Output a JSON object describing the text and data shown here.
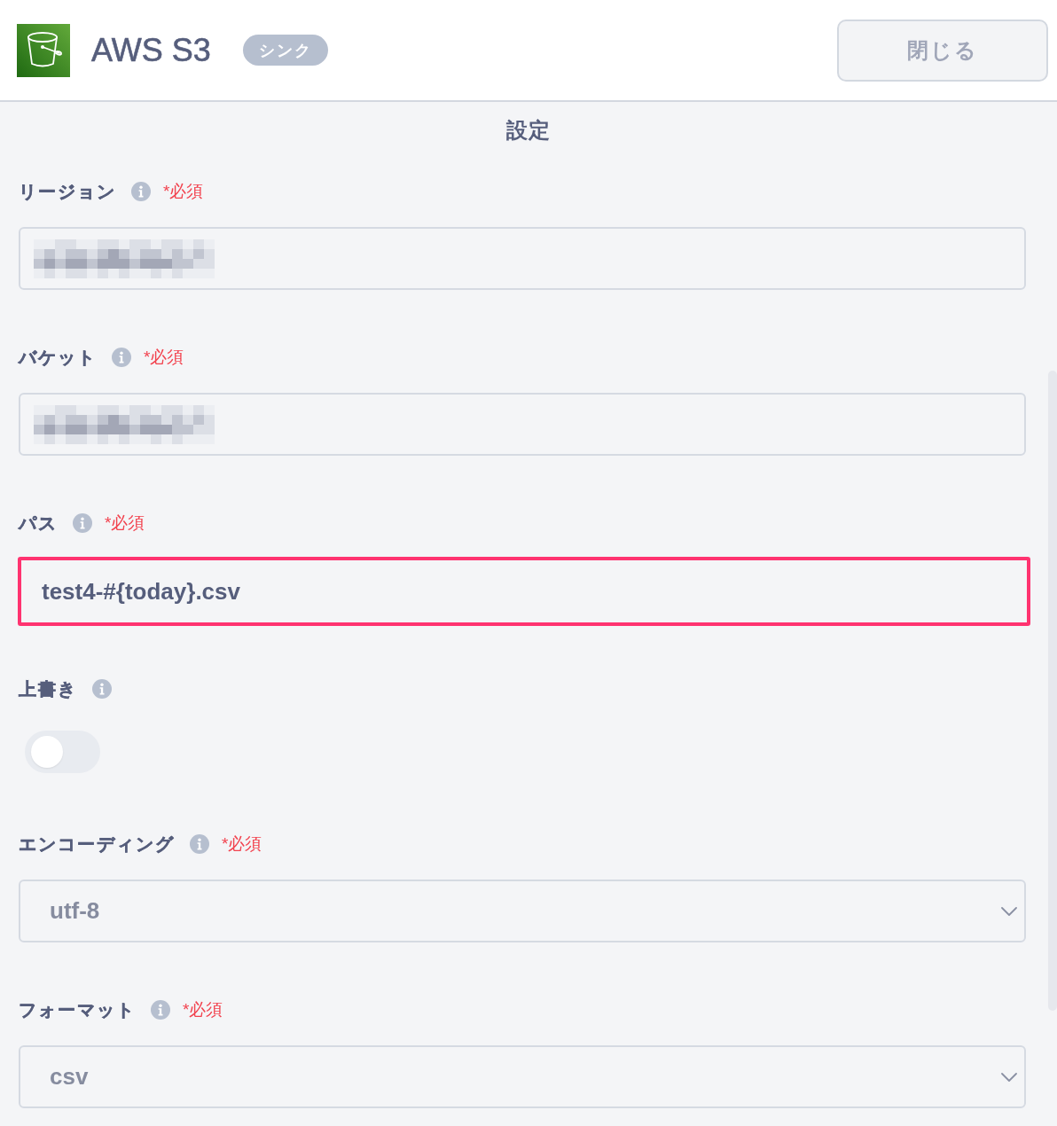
{
  "header": {
    "title": "AWS S3",
    "badge": "シンク",
    "close_button": "閉じる"
  },
  "section_title": "設定",
  "fields": [
    {
      "kind": "text",
      "label": "リージョン",
      "required_mark": "*必須",
      "redacted": true,
      "highlighted": false
    },
    {
      "kind": "text",
      "label": "バケット",
      "required_mark": "*必須",
      "redacted": true,
      "highlighted": false
    },
    {
      "kind": "text",
      "label": "パス",
      "required_mark": "*必須",
      "value": "test4-#{today}.csv",
      "highlighted": true
    },
    {
      "kind": "toggle",
      "label": "上書き",
      "on": false
    },
    {
      "kind": "select",
      "label": "エンコーディング",
      "required_mark": "*必須",
      "value": "utf-8"
    },
    {
      "kind": "select",
      "label": "フォーマット",
      "required_mark": "*必須",
      "value": "csv"
    }
  ]
}
